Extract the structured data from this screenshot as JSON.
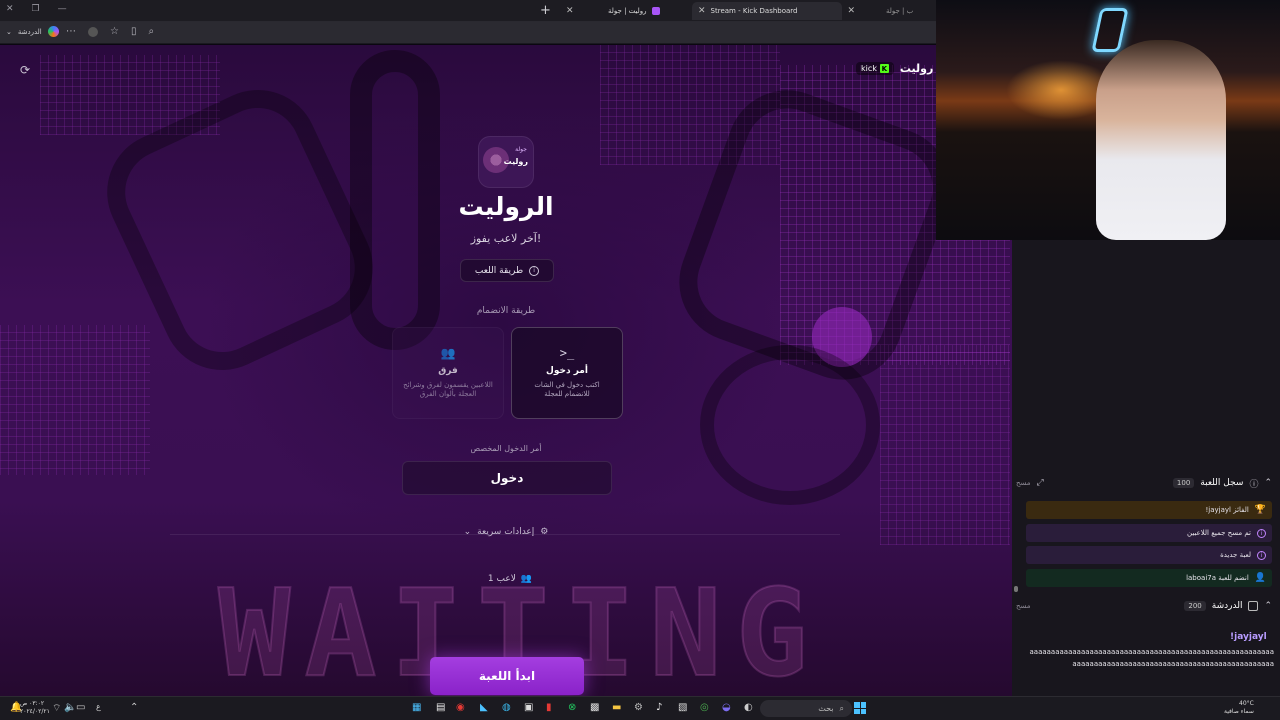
{
  "browser": {
    "tabs": [
      {
        "title": "Stream - Kick Dashboard",
        "color": "#53fc18"
      },
      {
        "title": "روليت | جولة",
        "color": "#a855f7"
      },
      {
        "title": "ب | جولة",
        "color": "#888888"
      }
    ],
    "copilot_label": "الدردشة"
  },
  "page": {
    "brand_name": "روليت",
    "kick_label": "kick",
    "logo_text": "روليت",
    "logo_subtext": "جولة",
    "title": "الروليت",
    "subtitle": "آخر لاعب يفوز!",
    "how_to_play": "طريقة اللعب",
    "join_label": "طريقة الانضمام",
    "cards": {
      "command": {
        "title": "أمر دخول",
        "desc": "اكتب دخول في الشات للانضمام للعجلة",
        "icon": ">_"
      },
      "teams": {
        "title": "فرق",
        "desc": "اللاعبين يقسمون لفرق وشرائح العجلة بألوان الفرق"
      }
    },
    "custom_cmd_label": "أمر الدخول المخصص",
    "custom_cmd_value": "دخول",
    "quick_settings": "إعدادات سريعة",
    "players": "1 لاعب",
    "start_button": "ابدأ اللعبة",
    "background_text": "WAITING"
  },
  "panel": {
    "log": {
      "title": "سجل اللعبة",
      "count": "100",
      "clear": "مسح",
      "items": [
        {
          "text": "!jayjayl الفائز",
          "bg": "#3a2a10",
          "color": "#f5b940",
          "icon": "🏆"
        },
        {
          "text": "تم مسح جميع اللاعبين",
          "bg": "#2a1d3a",
          "color": "#c084fc",
          "icon": "i"
        },
        {
          "text": "لعبة جديدة",
          "bg": "#2a1d3a",
          "color": "#c084fc",
          "icon": "i"
        },
        {
          "text": "laboai7a انضم للعبة",
          "bg": "#132a20",
          "color": "#4ade80",
          "icon": "+"
        }
      ]
    },
    "chat": {
      "title": "الدردشة",
      "count": "200",
      "clear": "مسح",
      "user": "!jayjayl",
      "message": "aaaaaaaaaaaaaaaaaaaaaaaaaaaaaaaaaaaaaaaaaaaaaaaaaaaaaaaaaaaaaaaaaaaaaaaaaaaaaaaaaaaaaaaaaaaaaaaaaaaaaaaa"
    }
  },
  "taskbar": {
    "time": "٠٣:٠٢ ص",
    "date": "٢٠٢٤/٠٢/٢١",
    "search": "بحث",
    "temp": "40°C",
    "weather": "سماء صافية"
  }
}
